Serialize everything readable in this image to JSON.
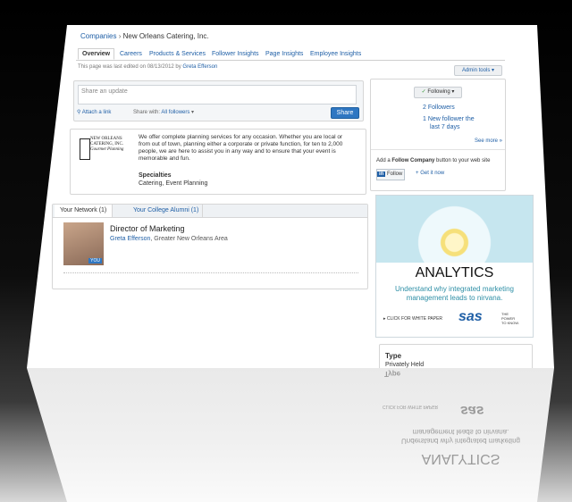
{
  "breadcrumb": {
    "companies": "Companies",
    "separator": "›",
    "company": "New Orleans Catering, Inc."
  },
  "tabs": [
    {
      "label": "Overview"
    },
    {
      "label": "Careers"
    },
    {
      "label": "Products & Services"
    },
    {
      "label": "Follower Insights"
    },
    {
      "label": "Page Insights"
    },
    {
      "label": "Employee Insights"
    }
  ],
  "edit_note": {
    "text": "This page was last edited on 08/13/2012 by",
    "user": "Greta Efferson"
  },
  "admin_tools": "Admin tools",
  "update_box": {
    "placeholder": "Share an update",
    "attach": "Attach a link",
    "share_with_label": "Share with:",
    "share_with_value": "All followers",
    "share_button": "Share"
  },
  "about": {
    "logo_line1": "NEW ORLEANS",
    "logo_line2": "CATERING, INC.",
    "logo_line3": "Gourmet Planning",
    "description": "We offer complete planning services for any occasion. Whether you are local or from out of town, planning either a corporate or private function, for ten to 2,000 people, we are here to assist you in any way and to ensure that your event is memorable and fun.",
    "specialties_label": "Specialties",
    "specialties": "Catering, Event Planning"
  },
  "network": {
    "tab1": "Your Network (1)",
    "tab2": "Your College Alumni (1)",
    "person_title": "Director of Marketing",
    "person_name": "Greta Efferson",
    "person_location": ", Greater New Orleans Area",
    "you_badge": "YOU"
  },
  "followers": {
    "following_label": "Following",
    "followers_count": "2",
    "followers_label": "Followers",
    "new_count": "1",
    "new_label_1": "New follower the",
    "new_label_2": "last 7 days",
    "see_more": "See more »",
    "add_follow_pre": "Add a",
    "add_follow_bold": "Follow Company",
    "add_follow_post": "button to your web site",
    "in_label": "in",
    "follow_label": "Follow",
    "get_it": "Get it now"
  },
  "ad": {
    "headline": "ANALYTICS",
    "line1": "Understand why integrated marketing",
    "line2": "management leads to nirvana.",
    "cta": "CLICK FOR WHITE PAPER",
    "brand": "sas",
    "tagline_1": "THE",
    "tagline_2": "POWER",
    "tagline_3": "TO KNOW.",
    "colors": {
      "teal": "#2e8fa6",
      "sky": "#c6e6ef",
      "petal": "#eef9fc"
    }
  },
  "type_box": {
    "label": "Type",
    "value": "Privately Held"
  },
  "reflection": {
    "cta": "CLICK FOR WHITE PAPER",
    "brand": "sas",
    "line1": "Understand why integrated marketing",
    "line2": "management leads to nirvana.",
    "headline": "ANALYTICS",
    "type": "Type"
  }
}
